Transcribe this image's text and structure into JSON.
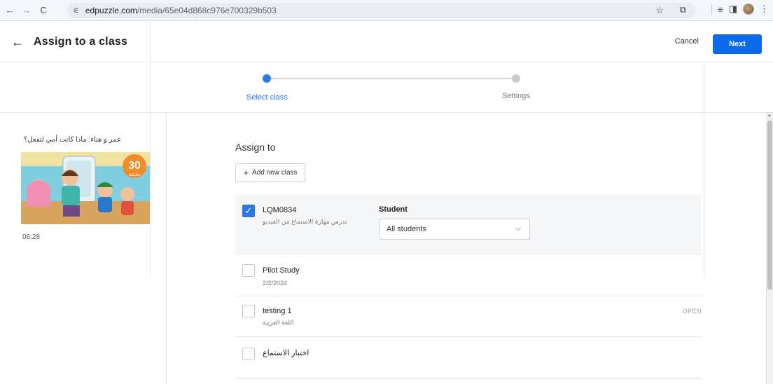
{
  "browser": {
    "url_host": "edpuzzle.com",
    "url_path": "/media/65e04d868c976e700329b503",
    "back_glyph": "←",
    "forward_glyph": "→",
    "reload_glyph": "C"
  },
  "header": {
    "title": "Assign to a class",
    "cancel_label": "Cancel",
    "next_label": "Next"
  },
  "stepper": {
    "steps": [
      {
        "label": "Select class",
        "active": true
      },
      {
        "label": "Settings",
        "active": false
      }
    ]
  },
  "media": {
    "title": "عمر و هناء: ماذا كانت أمي لتفعل؟",
    "duration": "06:28",
    "badge_number": "30",
    "badge_word": "دقيقة"
  },
  "assign": {
    "heading": "Assign to",
    "add_class_label": "Add new class",
    "classes": [
      {
        "name": "LQM0834",
        "subtitle": "تدرس مهارة الاستماع من الفيديو",
        "checked": true
      },
      {
        "name": "Pilot Study",
        "subtitle": "2/2/2024",
        "checked": false
      },
      {
        "name": "testing 1",
        "subtitle": "اللغة العربية",
        "checked": false,
        "badge": "OPEN"
      },
      {
        "name": "اختبار الاستماع",
        "subtitle": "",
        "checked": false
      }
    ],
    "student_label": "Student",
    "student_select_value": "All students"
  },
  "colors": {
    "primary": "#0b6aea",
    "step_active": "#2a78e4",
    "step_inactive": "#c8ccd2"
  }
}
